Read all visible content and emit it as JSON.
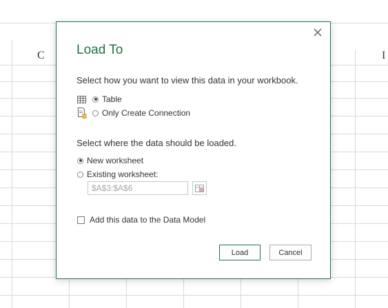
{
  "sheet": {
    "column_letters": [
      "C",
      "I"
    ]
  },
  "dialog": {
    "title": "Load To",
    "view_prompt": "Select how you want to view this data in your workbook.",
    "view_options": [
      {
        "label": "Table",
        "icon": "table-icon",
        "selected": true
      },
      {
        "label": "Only Create Connection",
        "icon": "connection-only-icon",
        "selected": false
      }
    ],
    "location_prompt": "Select where the data should be loaded.",
    "location_options": [
      {
        "label": "New worksheet",
        "selected": true
      },
      {
        "label": "Existing worksheet:",
        "selected": false
      }
    ],
    "range_value": "$A$3:$A$6",
    "data_model_label": "Add this data to the Data Model",
    "data_model_checked": false,
    "load_label": "Load",
    "cancel_label": "Cancel",
    "accent_color": "#217346"
  }
}
